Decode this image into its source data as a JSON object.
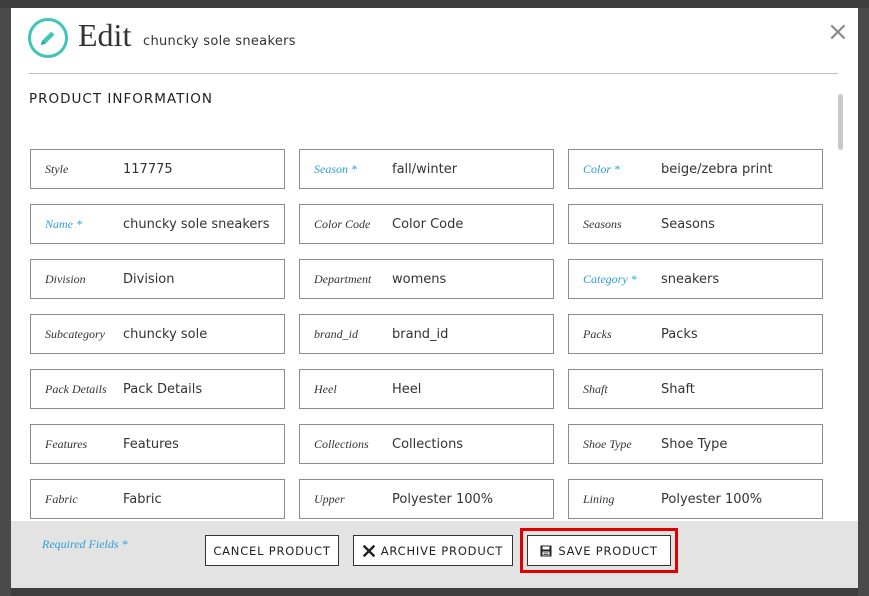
{
  "header": {
    "title": "Edit",
    "subtitle": "chuncky sole sneakers",
    "close_icon": "close-x",
    "edit_icon": "pencil"
  },
  "section": {
    "title": "PRODUCT INFORMATION"
  },
  "fields": [
    {
      "label": "Style",
      "value": "117775",
      "required": false
    },
    {
      "label": "Season *",
      "value": "fall/winter",
      "required": true
    },
    {
      "label": "Color *",
      "value": "beige/zebra print",
      "required": true
    },
    {
      "label": "Name *",
      "value": "chuncky sole sneakers",
      "required": true
    },
    {
      "label": "Color Code",
      "value": "Color Code",
      "required": false
    },
    {
      "label": "Seasons",
      "value": "Seasons",
      "required": false
    },
    {
      "label": "Division",
      "value": "Division",
      "required": false
    },
    {
      "label": "Department",
      "value": "womens",
      "required": false
    },
    {
      "label": "Category *",
      "value": "sneakers",
      "required": true
    },
    {
      "label": "Subcategory",
      "value": "chuncky sole",
      "required": false
    },
    {
      "label": "brand_id",
      "value": "brand_id",
      "required": false
    },
    {
      "label": "Packs",
      "value": "Packs",
      "required": false
    },
    {
      "label": "Pack Details",
      "value": "Pack Details",
      "required": false
    },
    {
      "label": "Heel",
      "value": "Heel",
      "required": false
    },
    {
      "label": "Shaft",
      "value": "Shaft",
      "required": false
    },
    {
      "label": "Features",
      "value": "Features",
      "required": false
    },
    {
      "label": "Collections",
      "value": "Collections",
      "required": false
    },
    {
      "label": "Shoe Type",
      "value": "Shoe Type",
      "required": false
    },
    {
      "label": "Fabric",
      "value": "Fabric",
      "required": false
    },
    {
      "label": "Upper",
      "value": "Polyester 100%",
      "required": false
    },
    {
      "label": "Lining",
      "value": "Polyester 100%",
      "required": false
    }
  ],
  "footer": {
    "required_note": "Required Fields *",
    "cancel_label": "CANCEL PRODUCT",
    "archive_label": "ARCHIVE PRODUCT",
    "save_label": "SAVE PRODUCT"
  },
  "colors": {
    "accent_teal": "#3fc4b7",
    "required_blue": "#2a9fd8",
    "highlight_red": "#e00000"
  }
}
